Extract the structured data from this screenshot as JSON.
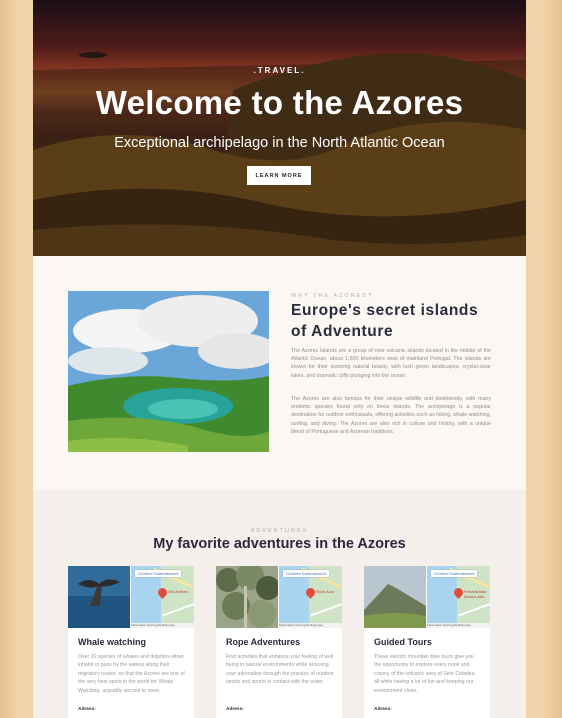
{
  "hero": {
    "kicker": ".TRAVEL.",
    "title": "Welcome to the Azores",
    "subtitle": "Exceptional archipelago in the North Atlantic Ocean",
    "button_label": "LEARN MORE"
  },
  "about": {
    "kicker": "WHY THE AZORES?",
    "title": "Europe's secret islands of Adventure",
    "paragraphs": [
      "The Azores Islands are a group of nine volcanic islands located in the middle of the Atlantic Ocean, about 1,500 kilometers west of mainland Portugal. The islands are known for their stunning natural beauty, with lush green landscapes, crystal-clear lakes, and dramatic cliffs plunging into the ocean.",
      "The Azores are also famous for their unique wildlife and biodiversity, with many endemic species found only on these islands. The archipelago is a popular destination for outdoor enthusiasts, offering activities such as hiking, whale watching, surfing, and diving. The Azores are also rich in culture and history, with a unique blend of Portuguese and Azorean traditions."
    ]
  },
  "adventures": {
    "kicker": "ADVENTURES",
    "title": "My favorite adventures in the Azores",
    "cards": [
      {
        "title": "Whale watching",
        "description": "Over 20 species of whales and dolphins either inhabit or pass by the waters along their migratory routes, so that the Azores are one of the very best spots in the world for Whale Watching, arguably second to none.",
        "address_label": "Adress:",
        "map_tag": "Größere Kartenansicht",
        "map_pin_label": "OM Azores",
        "map_footer": "Kartendaten  Nutzungsbedingungen"
      },
      {
        "title": "Rope Adventures",
        "description": "Find activities that enhance your feeling of well being in natural environments while arousing your adrenaline through the practice of outdoor sports and sports in contact with the water.",
        "address_label": "Adress:",
        "map_tag": "Größere Kartenansicht",
        "map_pin_label": "Rock Azul",
        "map_footer": "Kartendaten  Nutzungsbedingungen"
      },
      {
        "title": "Guided Tours",
        "description": "These electric mountain bike tours give you the opportunity to explore every nook and cranny of the volcanic area of Sete Cidades, all while having a lot of fun and keeping our environment clean.",
        "address_label": "Adress:",
        "map_tag": "Größere Kartenansicht",
        "map_pin_label": "Ferraria bike Azores Adv.",
        "map_footer": "Kartendaten  Nutzungsbedingungen"
      }
    ]
  }
}
